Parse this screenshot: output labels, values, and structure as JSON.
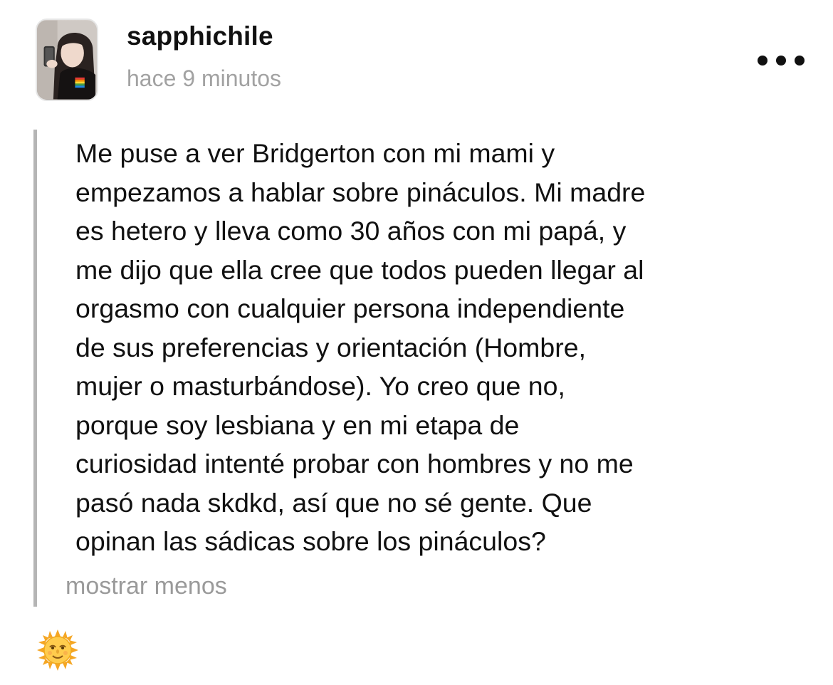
{
  "post": {
    "author": "sapphichile",
    "timestamp": "hace 9 minutos",
    "lines": [
      "Me puse a ver Bridgerton con mi mami y",
      "empezamos a hablar sobre pináculos. Mi madre",
      "es hetero y lleva como 30 años con mi papá, y",
      "me dijo que ella cree que todos pueden llegar al",
      "orgasmo con cualquier persona independiente",
      "de sus preferencias y orientación (Hombre,",
      "mujer o masturbándose). Yo creo que no,",
      "porque soy lesbiana y en mi etapa de",
      "curiosidad intenté probar con hombres y no me",
      "pasó nada skdkd, así que no sé gente. Que",
      "opinan las sádicas sobre los pináculos?"
    ],
    "show_less_label": "mostrar menos",
    "reaction_icon": "sun-with-face-emoji"
  },
  "icons": {
    "more": "more-horizontal-icon",
    "avatar": "profile-photo"
  },
  "colors": {
    "text": "#111111",
    "muted": "#a2a2a2",
    "quote_bar": "#b5b5b5"
  }
}
